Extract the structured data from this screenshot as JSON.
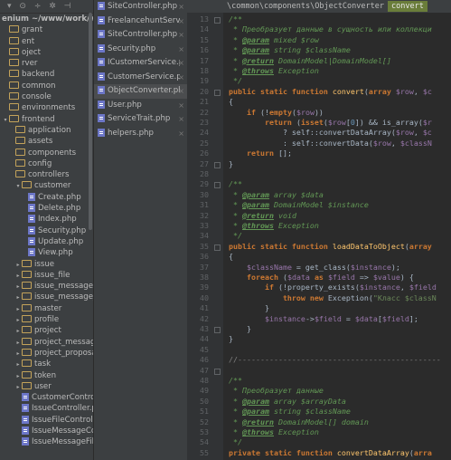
{
  "tree": {
    "toolbar_title": "enium ~/www/work/wpio",
    "items": [
      {
        "label": "grant",
        "type": "folder",
        "indent": 0,
        "arrow": ""
      },
      {
        "label": "ent",
        "type": "folder",
        "indent": 0,
        "arrow": ""
      },
      {
        "label": "oject",
        "type": "folder",
        "indent": 0,
        "arrow": ""
      },
      {
        "label": "rver",
        "type": "folder",
        "indent": 0,
        "arrow": ""
      },
      {
        "label": "backend",
        "type": "folder",
        "indent": 0,
        "arrow": ""
      },
      {
        "label": "common",
        "type": "folder",
        "indent": 0,
        "arrow": ""
      },
      {
        "label": "console",
        "type": "folder",
        "indent": 0,
        "arrow": ""
      },
      {
        "label": "environments",
        "type": "folder",
        "indent": 0,
        "arrow": ""
      },
      {
        "label": "frontend",
        "type": "folder",
        "indent": 0,
        "arrow": "▾"
      },
      {
        "label": "application",
        "type": "folder",
        "indent": 1,
        "arrow": ""
      },
      {
        "label": "assets",
        "type": "folder",
        "indent": 1,
        "arrow": ""
      },
      {
        "label": "components",
        "type": "folder",
        "indent": 1,
        "arrow": ""
      },
      {
        "label": "config",
        "type": "folder",
        "indent": 1,
        "arrow": ""
      },
      {
        "label": "controllers",
        "type": "folder",
        "indent": 1,
        "arrow": ""
      },
      {
        "label": "customer",
        "type": "folder",
        "indent": 2,
        "arrow": "▾"
      },
      {
        "label": "Create.php",
        "type": "file",
        "indent": 3,
        "arrow": ""
      },
      {
        "label": "Delete.php",
        "type": "file",
        "indent": 3,
        "arrow": ""
      },
      {
        "label": "Index.php",
        "type": "file",
        "indent": 3,
        "arrow": ""
      },
      {
        "label": "Security.php",
        "type": "file",
        "indent": 3,
        "arrow": ""
      },
      {
        "label": "Update.php",
        "type": "file",
        "indent": 3,
        "arrow": ""
      },
      {
        "label": "View.php",
        "type": "file",
        "indent": 3,
        "arrow": ""
      },
      {
        "label": "issue",
        "type": "folder",
        "indent": 2,
        "arrow": "▸"
      },
      {
        "label": "issue_file",
        "type": "folder",
        "indent": 2,
        "arrow": "▸"
      },
      {
        "label": "issue_message",
        "type": "folder",
        "indent": 2,
        "arrow": "▸"
      },
      {
        "label": "issue_message_file",
        "type": "folder",
        "indent": 2,
        "arrow": "▸"
      },
      {
        "label": "master",
        "type": "folder",
        "indent": 2,
        "arrow": "▸"
      },
      {
        "label": "profile",
        "type": "folder",
        "indent": 2,
        "arrow": "▸"
      },
      {
        "label": "project",
        "type": "folder",
        "indent": 2,
        "arrow": "▸"
      },
      {
        "label": "project_message",
        "type": "folder",
        "indent": 2,
        "arrow": "▸"
      },
      {
        "label": "project_proposal_m",
        "type": "folder",
        "indent": 2,
        "arrow": "▸"
      },
      {
        "label": "task",
        "type": "folder",
        "indent": 2,
        "arrow": "▸"
      },
      {
        "label": "token",
        "type": "folder",
        "indent": 2,
        "arrow": "▸"
      },
      {
        "label": "user",
        "type": "folder",
        "indent": 2,
        "arrow": "▸"
      },
      {
        "label": "CustomerController.",
        "type": "file",
        "indent": 2,
        "arrow": ""
      },
      {
        "label": "IssueController.php",
        "type": "file",
        "indent": 2,
        "arrow": ""
      },
      {
        "label": "IssueFileController.p",
        "type": "file",
        "indent": 2,
        "arrow": ""
      },
      {
        "label": "IssueMessageContro",
        "type": "file",
        "indent": 2,
        "arrow": ""
      },
      {
        "label": "IssueMessageFileCo",
        "type": "file",
        "indent": 2,
        "arrow": ""
      }
    ]
  },
  "open_files": [
    {
      "label": "SiteController.php",
      "active": false
    },
    {
      "label": "FreelancehuntServic",
      "active": false
    },
    {
      "label": "SiteController.php",
      "active": false
    },
    {
      "label": "Security.php",
      "active": false
    },
    {
      "label": "ICustomerService.ph",
      "active": false
    },
    {
      "label": "CustomerService.ph",
      "active": false
    },
    {
      "label": "ObjectConverter.ph",
      "active": true
    },
    {
      "label": "User.php",
      "active": false
    },
    {
      "label": "ServiceTrait.php",
      "active": false
    },
    {
      "label": "helpers.php",
      "active": false
    }
  ],
  "editor": {
    "breadcrumb_path": "\\common\\components\\ObjectConverter",
    "breadcrumb_method": "convert",
    "line_start": 13,
    "line_end": 55,
    "lines": [
      [
        {
          "t": "/**",
          "c": "c"
        }
      ],
      [
        {
          "t": " * Преобразует данные в сущность или коллекци",
          "c": "c"
        }
      ],
      [
        {
          "t": " * ",
          "c": "c"
        },
        {
          "t": "@param",
          "c": "t"
        },
        {
          "t": " mixed $row",
          "c": "c"
        }
      ],
      [
        {
          "t": " * ",
          "c": "c"
        },
        {
          "t": "@param",
          "c": "t"
        },
        {
          "t": " string $className",
          "c": "c"
        }
      ],
      [
        {
          "t": " * ",
          "c": "c"
        },
        {
          "t": "@return",
          "c": "t"
        },
        {
          "t": " DomainModel|DomainModel[]",
          "c": "c"
        }
      ],
      [
        {
          "t": " * ",
          "c": "c"
        },
        {
          "t": "@throws",
          "c": "t"
        },
        {
          "t": " Exception",
          "c": "c"
        }
      ],
      [
        {
          "t": " */",
          "c": "c"
        }
      ],
      [
        {
          "t": "public static function ",
          "c": "k"
        },
        {
          "t": "convert",
          "c": "f"
        },
        {
          "t": "(",
          "c": "p"
        },
        {
          "t": "array ",
          "c": "k"
        },
        {
          "t": "$row",
          "c": "v"
        },
        {
          "t": ", ",
          "c": "p"
        },
        {
          "t": "$c",
          "c": "v"
        }
      ],
      [
        {
          "t": "{",
          "c": "p"
        }
      ],
      [
        {
          "t": "    if ",
          "c": "k"
        },
        {
          "t": "(!",
          "c": "p"
        },
        {
          "t": "empty",
          "c": "k"
        },
        {
          "t": "(",
          "c": "p"
        },
        {
          "t": "$row",
          "c": "v"
        },
        {
          "t": "))",
          "c": "p"
        }
      ],
      [
        {
          "t": "        return ",
          "c": "k"
        },
        {
          "t": "(",
          "c": "p"
        },
        {
          "t": "isset",
          "c": "k"
        },
        {
          "t": "(",
          "c": "p"
        },
        {
          "t": "$row",
          "c": "v"
        },
        {
          "t": "[",
          "c": "p"
        },
        {
          "t": "0",
          "c": "n"
        },
        {
          "t": "]) && is_array(",
          "c": "p"
        },
        {
          "t": "$r",
          "c": "v"
        }
      ],
      [
        {
          "t": "            ? self::convertDataArray(",
          "c": "p"
        },
        {
          "t": "$row",
          "c": "v"
        },
        {
          "t": ", ",
          "c": "p"
        },
        {
          "t": "$c",
          "c": "v"
        }
      ],
      [
        {
          "t": "            : self::convertData(",
          "c": "p"
        },
        {
          "t": "$row",
          "c": "v"
        },
        {
          "t": ", ",
          "c": "p"
        },
        {
          "t": "$classN",
          "c": "v"
        }
      ],
      [
        {
          "t": "    return ",
          "c": "k"
        },
        {
          "t": "[];",
          "c": "p"
        }
      ],
      [
        {
          "t": "}",
          "c": "p"
        }
      ],
      [
        {
          "t": "",
          "c": "p"
        }
      ],
      [
        {
          "t": "/**",
          "c": "c"
        }
      ],
      [
        {
          "t": " * ",
          "c": "c"
        },
        {
          "t": "@param",
          "c": "t"
        },
        {
          "t": " array $data",
          "c": "c"
        }
      ],
      [
        {
          "t": " * ",
          "c": "c"
        },
        {
          "t": "@param",
          "c": "t"
        },
        {
          "t": " DomainModel $instance",
          "c": "c"
        }
      ],
      [
        {
          "t": " * ",
          "c": "c"
        },
        {
          "t": "@return",
          "c": "t"
        },
        {
          "t": " void",
          "c": "c"
        }
      ],
      [
        {
          "t": " * ",
          "c": "c"
        },
        {
          "t": "@throws",
          "c": "t"
        },
        {
          "t": " Exception",
          "c": "c"
        }
      ],
      [
        {
          "t": " */",
          "c": "c"
        }
      ],
      [
        {
          "t": "public static function ",
          "c": "k"
        },
        {
          "t": "loadDataToObject",
          "c": "f"
        },
        {
          "t": "(",
          "c": "p"
        },
        {
          "t": "array",
          "c": "k"
        }
      ],
      [
        {
          "t": "{",
          "c": "p"
        }
      ],
      [
        {
          "t": "    ",
          "c": "p"
        },
        {
          "t": "$className",
          "c": "v"
        },
        {
          "t": " = get_class(",
          "c": "p"
        },
        {
          "t": "$instance",
          "c": "v"
        },
        {
          "t": ");",
          "c": "p"
        }
      ],
      [
        {
          "t": "    foreach ",
          "c": "k"
        },
        {
          "t": "(",
          "c": "p"
        },
        {
          "t": "$data ",
          "c": "v"
        },
        {
          "t": "as ",
          "c": "k"
        },
        {
          "t": "$field",
          "c": "v"
        },
        {
          "t": " => ",
          "c": "p"
        },
        {
          "t": "$value",
          "c": "v"
        },
        {
          "t": ") {",
          "c": "p"
        }
      ],
      [
        {
          "t": "        if ",
          "c": "k"
        },
        {
          "t": "(!property_exists(",
          "c": "p"
        },
        {
          "t": "$instance",
          "c": "v"
        },
        {
          "t": ", ",
          "c": "p"
        },
        {
          "t": "$field",
          "c": "v"
        }
      ],
      [
        {
          "t": "            throw new ",
          "c": "k"
        },
        {
          "t": "Exception(",
          "c": "p"
        },
        {
          "t": "\"Класс $classN",
          "c": "s"
        }
      ],
      [
        {
          "t": "        }",
          "c": "p"
        }
      ],
      [
        {
          "t": "        ",
          "c": "p"
        },
        {
          "t": "$instance",
          "c": "v"
        },
        {
          "t": "->",
          "c": "p"
        },
        {
          "t": "$field",
          "c": "v"
        },
        {
          "t": " = ",
          "c": "p"
        },
        {
          "t": "$data",
          "c": "v"
        },
        {
          "t": "[",
          "c": "p"
        },
        {
          "t": "$field",
          "c": "v"
        },
        {
          "t": "];",
          "c": "p"
        }
      ],
      [
        {
          "t": "    }",
          "c": "p"
        }
      ],
      [
        {
          "t": "}",
          "c": "p"
        }
      ],
      [
        {
          "t": "",
          "c": "p"
        }
      ],
      [
        {
          "t": "//---------------------------------------------",
          "c": "sep"
        }
      ],
      [
        {
          "t": "",
          "c": "p"
        }
      ],
      [
        {
          "t": "/**",
          "c": "c"
        }
      ],
      [
        {
          "t": " * Преобразует данные",
          "c": "c"
        }
      ],
      [
        {
          "t": " * ",
          "c": "c"
        },
        {
          "t": "@param",
          "c": "t"
        },
        {
          "t": " array $arrayData",
          "c": "c"
        }
      ],
      [
        {
          "t": " * ",
          "c": "c"
        },
        {
          "t": "@param",
          "c": "t"
        },
        {
          "t": " string $className",
          "c": "c"
        }
      ],
      [
        {
          "t": " * ",
          "c": "c"
        },
        {
          "t": "@return",
          "c": "t"
        },
        {
          "t": " DomainModel[] domain",
          "c": "c"
        }
      ],
      [
        {
          "t": " * ",
          "c": "c"
        },
        {
          "t": "@throws",
          "c": "t"
        },
        {
          "t": " Exception",
          "c": "c"
        }
      ],
      [
        {
          "t": " */",
          "c": "c"
        }
      ],
      [
        {
          "t": "private static function ",
          "c": "k"
        },
        {
          "t": "convertDataArray",
          "c": "f"
        },
        {
          "t": "(",
          "c": "p"
        },
        {
          "t": "arra",
          "c": "k"
        }
      ]
    ]
  }
}
